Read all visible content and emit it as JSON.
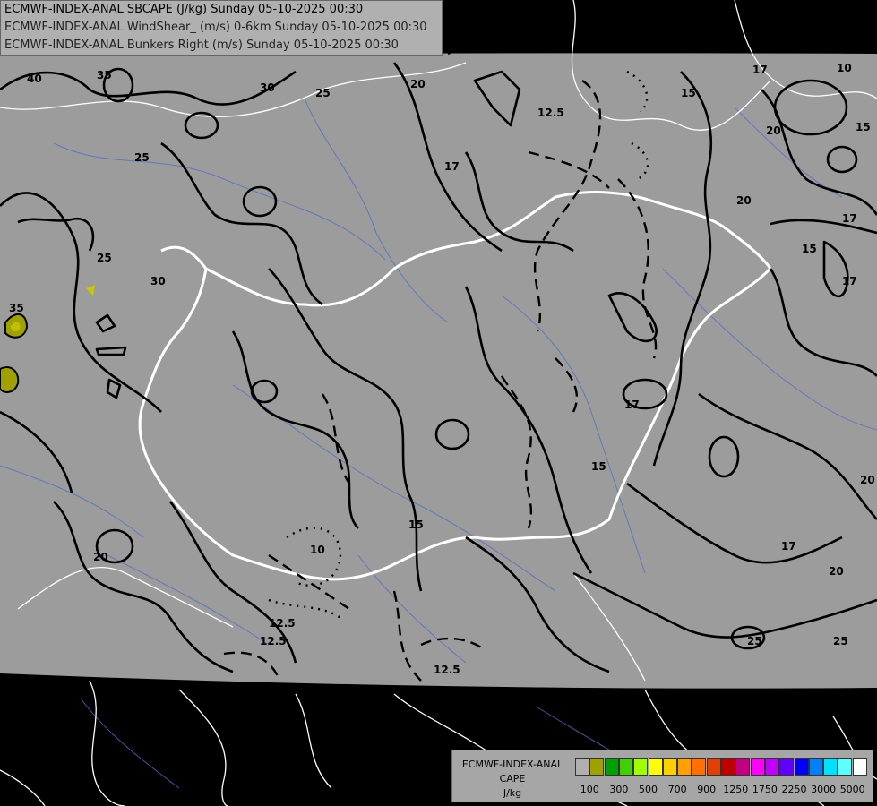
{
  "header": {
    "line1": "ECMWF-INDEX-ANAL SBCAPE (J/kg) Sunday 05-10-2025 00:30",
    "line2": "ECMWF-INDEX-ANAL WindShear_ (m/s) 0-6km Sunday 05-10-2025 00:30",
    "line3": "ECMWF-INDEX-ANAL Bunkers Right (m/s) Sunday 05-10-2025 00:30"
  },
  "legend": {
    "title_line1": "ECMWF-INDEX-ANAL",
    "title_line2": "CAPE",
    "title_line3": "J/kg",
    "colors": [
      "#b0b0b0",
      "#a0a000",
      "#00a000",
      "#40d000",
      "#a0ff00",
      "#ffff00",
      "#ffd000",
      "#ffa000",
      "#ff7000",
      "#e04000",
      "#c00000",
      "#c00080",
      "#ff00ff",
      "#c000ff",
      "#6000ff",
      "#0000ff",
      "#0080ff",
      "#00e0ff",
      "#60ffff",
      "#ffffff"
    ],
    "ticks": [
      "100",
      "300",
      "500",
      "700",
      "900",
      "1250",
      "1750",
      "2250",
      "3000",
      "5000"
    ]
  },
  "contour_labels": [
    "40",
    "35",
    "30",
    "25",
    "20",
    "17",
    "15",
    "12.5",
    "10",
    "15",
    "20",
    "25",
    "30",
    "35",
    "12.5",
    "17",
    "20",
    "25",
    "15",
    "17",
    "12.5",
    "17",
    "20",
    "15",
    "10",
    "20",
    "25",
    "17",
    "15",
    "12.5",
    "17",
    "20",
    "25"
  ]
}
